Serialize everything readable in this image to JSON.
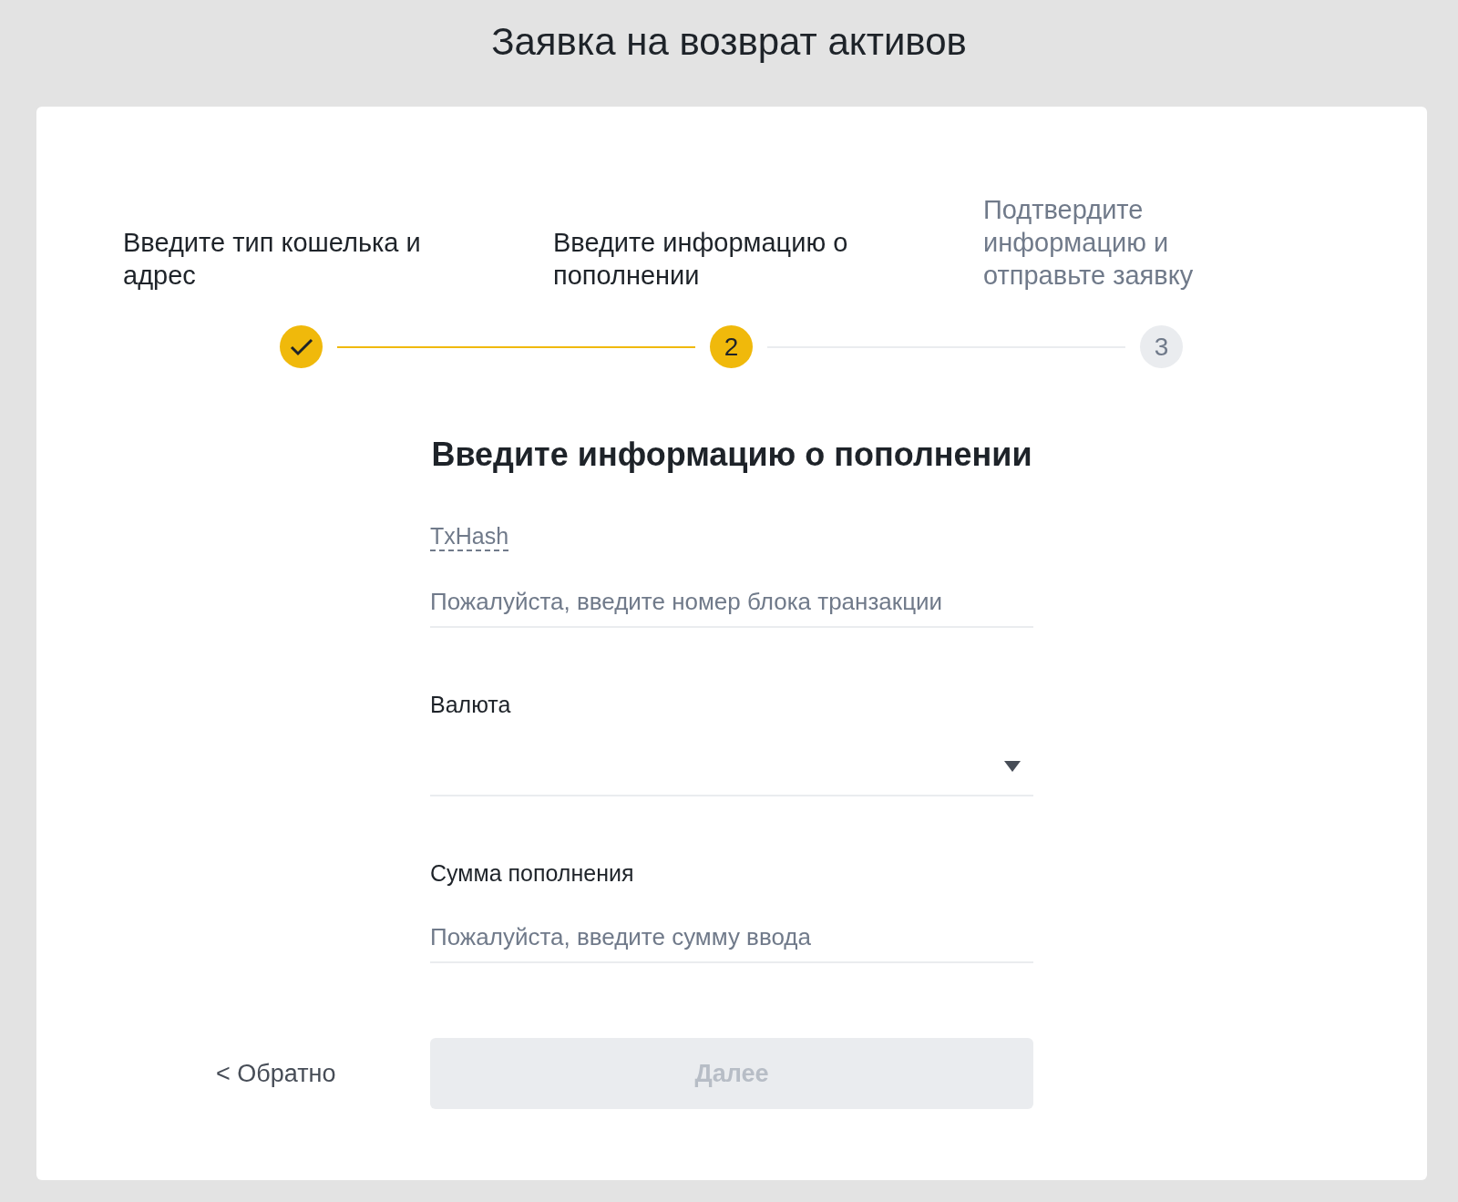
{
  "title": "Заявка на возврат активов",
  "steps": [
    {
      "label": "Введите тип кошелька и адрес",
      "done": true,
      "selected": false
    },
    {
      "label": "Введите информацию о пополнении",
      "number": "2",
      "done": false,
      "selected": true
    },
    {
      "label": "Подтвердите информацию и отправьте заявку",
      "number": "3",
      "done": false,
      "selected": false
    }
  ],
  "heading": "Введите информацию о пополнении",
  "fields": [
    {
      "kind": "text",
      "label": "TxHash",
      "hint_label": true,
      "placeholder": "Пожалуйста, введите номер блока транзакции"
    },
    {
      "kind": "select",
      "label": "Валюта",
      "hint_label": false
    },
    {
      "kind": "text",
      "label": "Сумма пополнения",
      "hint_label": false,
      "placeholder": "Пожалуйста, введите сумму ввода"
    }
  ],
  "back": "< Обратно",
  "next": {
    "label": "Далее",
    "disabled": true
  }
}
